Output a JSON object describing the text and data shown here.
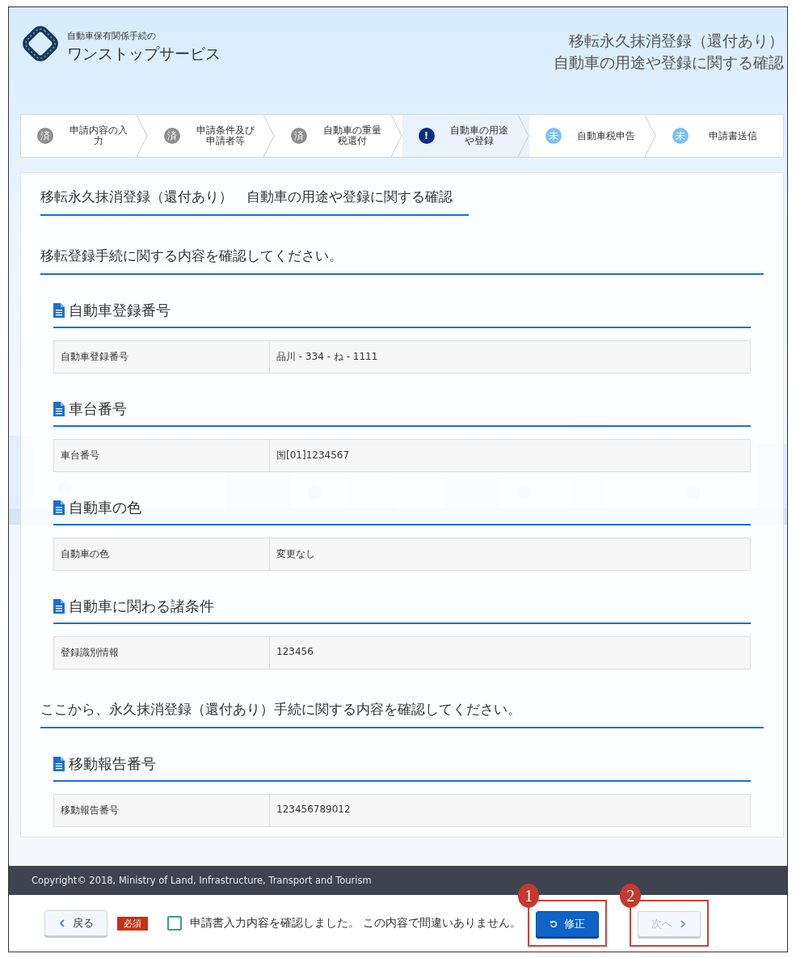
{
  "header": {
    "logo_caption": "自動車保有関係手続の",
    "logo_title": "ワンストップサービス",
    "page_title_lines": [
      "移転永久抹消登録（還付あり）",
      "自動車の用途や登録に関する確認"
    ]
  },
  "steps": [
    {
      "mark": "済",
      "lines": [
        "申請内容の入",
        "力"
      ],
      "kind": "done",
      "selected": false
    },
    {
      "mark": "済",
      "lines": [
        "申請条件及び",
        "申請者等"
      ],
      "kind": "done",
      "selected": false
    },
    {
      "mark": "済",
      "lines": [
        "自動車の重量",
        "税還付"
      ],
      "kind": "done",
      "selected": false
    },
    {
      "mark": "!",
      "lines": [
        "自動車の用途",
        "や登録"
      ],
      "kind": "current",
      "selected": true
    },
    {
      "mark": "未",
      "lines": [
        "自動車税申告"
      ],
      "kind": "todo",
      "selected": false
    },
    {
      "mark": "未",
      "lines": [
        "申請書送信"
      ],
      "kind": "todo",
      "selected": false
    }
  ],
  "content": {
    "title": "移転永久抹消登録（還付あり）　自動車の用途や登録に関する確認",
    "sections": [
      {
        "intro": "移転登録手続に関する内容を確認してください。",
        "groups": [
          {
            "heading": "自動車登録番号",
            "label": "自動車登録番号",
            "value": "品川 - 334 - ね - 1111"
          },
          {
            "heading": "車台番号",
            "label": "車台番号",
            "value": "国[01]1234567"
          },
          {
            "heading": "自動車の色",
            "label": "自動車の色",
            "value": "変更なし"
          },
          {
            "heading": "自動車に関わる諸条件",
            "label": "登録識別情報",
            "value": "123456"
          }
        ]
      },
      {
        "intro": "ここから、永久抹消登録（還付あり）手続に関する内容を確認してください。",
        "groups": [
          {
            "heading": "移動報告番号",
            "label": "移動報告番号",
            "value": "123456789012"
          }
        ]
      }
    ]
  },
  "footer": {
    "copyright": "Copyright© 2018, Ministry of Land, Infrastructure, Transport and Tourism"
  },
  "action_bar": {
    "back_button": "戻る",
    "required_badge": "必須",
    "confirm_checkbox": {
      "label": "申請書入力内容を確認しました。 この内容で間違いありません。",
      "checked": false
    },
    "fix_button": {
      "label": "修正",
      "disabled": false,
      "callout": "1"
    },
    "next_button": {
      "label": "次へ",
      "disabled": true,
      "callout": "2"
    }
  }
}
